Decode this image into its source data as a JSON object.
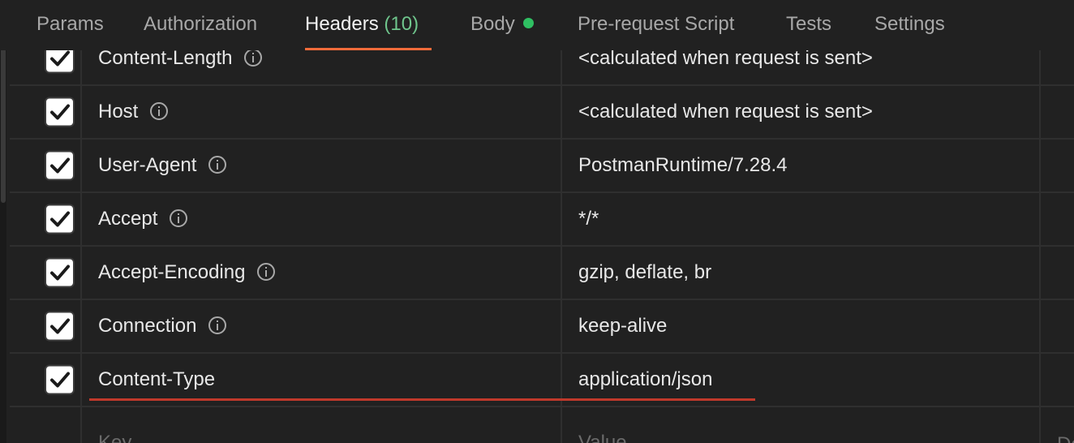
{
  "tabs": [
    {
      "label": "Params"
    },
    {
      "label": "Authorization"
    },
    {
      "label": "Headers",
      "count": "(10)",
      "active": true
    },
    {
      "label": "Body",
      "status_dot_color": "#2fbf62"
    },
    {
      "label": "Pre-request Script"
    },
    {
      "label": "Tests"
    },
    {
      "label": "Settings"
    }
  ],
  "headers": [
    {
      "checked": true,
      "key": "Content-Length",
      "info": true,
      "value": "<calculated when request is sent>"
    },
    {
      "checked": true,
      "key": "Host",
      "info": true,
      "value": "<calculated when request is sent>"
    },
    {
      "checked": true,
      "key": "User-Agent",
      "info": true,
      "value": "PostmanRuntime/7.28.4"
    },
    {
      "checked": true,
      "key": "Accept",
      "info": true,
      "value": "*/*"
    },
    {
      "checked": true,
      "key": "Accept-Encoding",
      "info": true,
      "value": "gzip, deflate, br"
    },
    {
      "checked": true,
      "key": "Connection",
      "info": true,
      "value": "keep-alive"
    },
    {
      "checked": true,
      "key": "Content-Type",
      "info": false,
      "value": "application/json"
    }
  ],
  "new_row": {
    "key_placeholder": "Key",
    "value_placeholder": "Value",
    "description_placeholder": "De"
  },
  "colors": {
    "active_tab_underline": "#f26b3a",
    "count_color": "#6fc58c",
    "annotation_underline": "#c0392b"
  }
}
